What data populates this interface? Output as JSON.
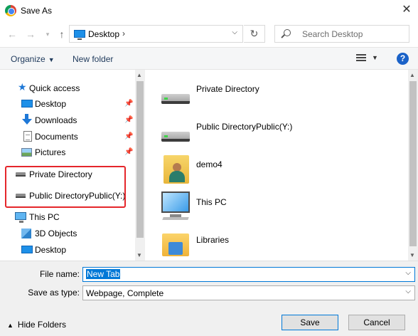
{
  "window": {
    "title": "Save As",
    "close_label": "✕"
  },
  "nav": {
    "address": "Desktop",
    "address_separator": "›",
    "search_placeholder": "Search Desktop"
  },
  "toolbar": {
    "organize": "Organize",
    "new_folder": "New folder",
    "help": "?"
  },
  "sidebar": {
    "items": [
      {
        "label": "Quick access"
      },
      {
        "label": "Desktop"
      },
      {
        "label": "Downloads"
      },
      {
        "label": "Documents"
      },
      {
        "label": "Pictures"
      },
      {
        "label": "Private Directory"
      },
      {
        "label": "Public DirectoryPublic(Y:)"
      },
      {
        "label": "This PC"
      },
      {
        "label": "3D Objects"
      },
      {
        "label": "Desktop"
      }
    ]
  },
  "content": {
    "items": [
      {
        "name": "Private Directory",
        "icon": "drive-icon"
      },
      {
        "name": "Public DirectoryPublic(Y:)",
        "icon": "drive-icon"
      },
      {
        "name": "demo4",
        "icon": "user-folder-icon"
      },
      {
        "name": "This PC",
        "icon": "this-pc-icon"
      },
      {
        "name": "Libraries",
        "icon": "libraries-icon"
      }
    ]
  },
  "form": {
    "file_name_label": "File name:",
    "file_name_value": "New Tab",
    "save_type_label": "Save as type:",
    "save_type_value": "Webpage, Complete"
  },
  "footer": {
    "hide_folders": "Hide Folders",
    "save": "Save",
    "cancel": "Cancel"
  },
  "colors": {
    "accent": "#0078d7",
    "highlight_box": "#e5262b",
    "help": "#1a62c8"
  }
}
